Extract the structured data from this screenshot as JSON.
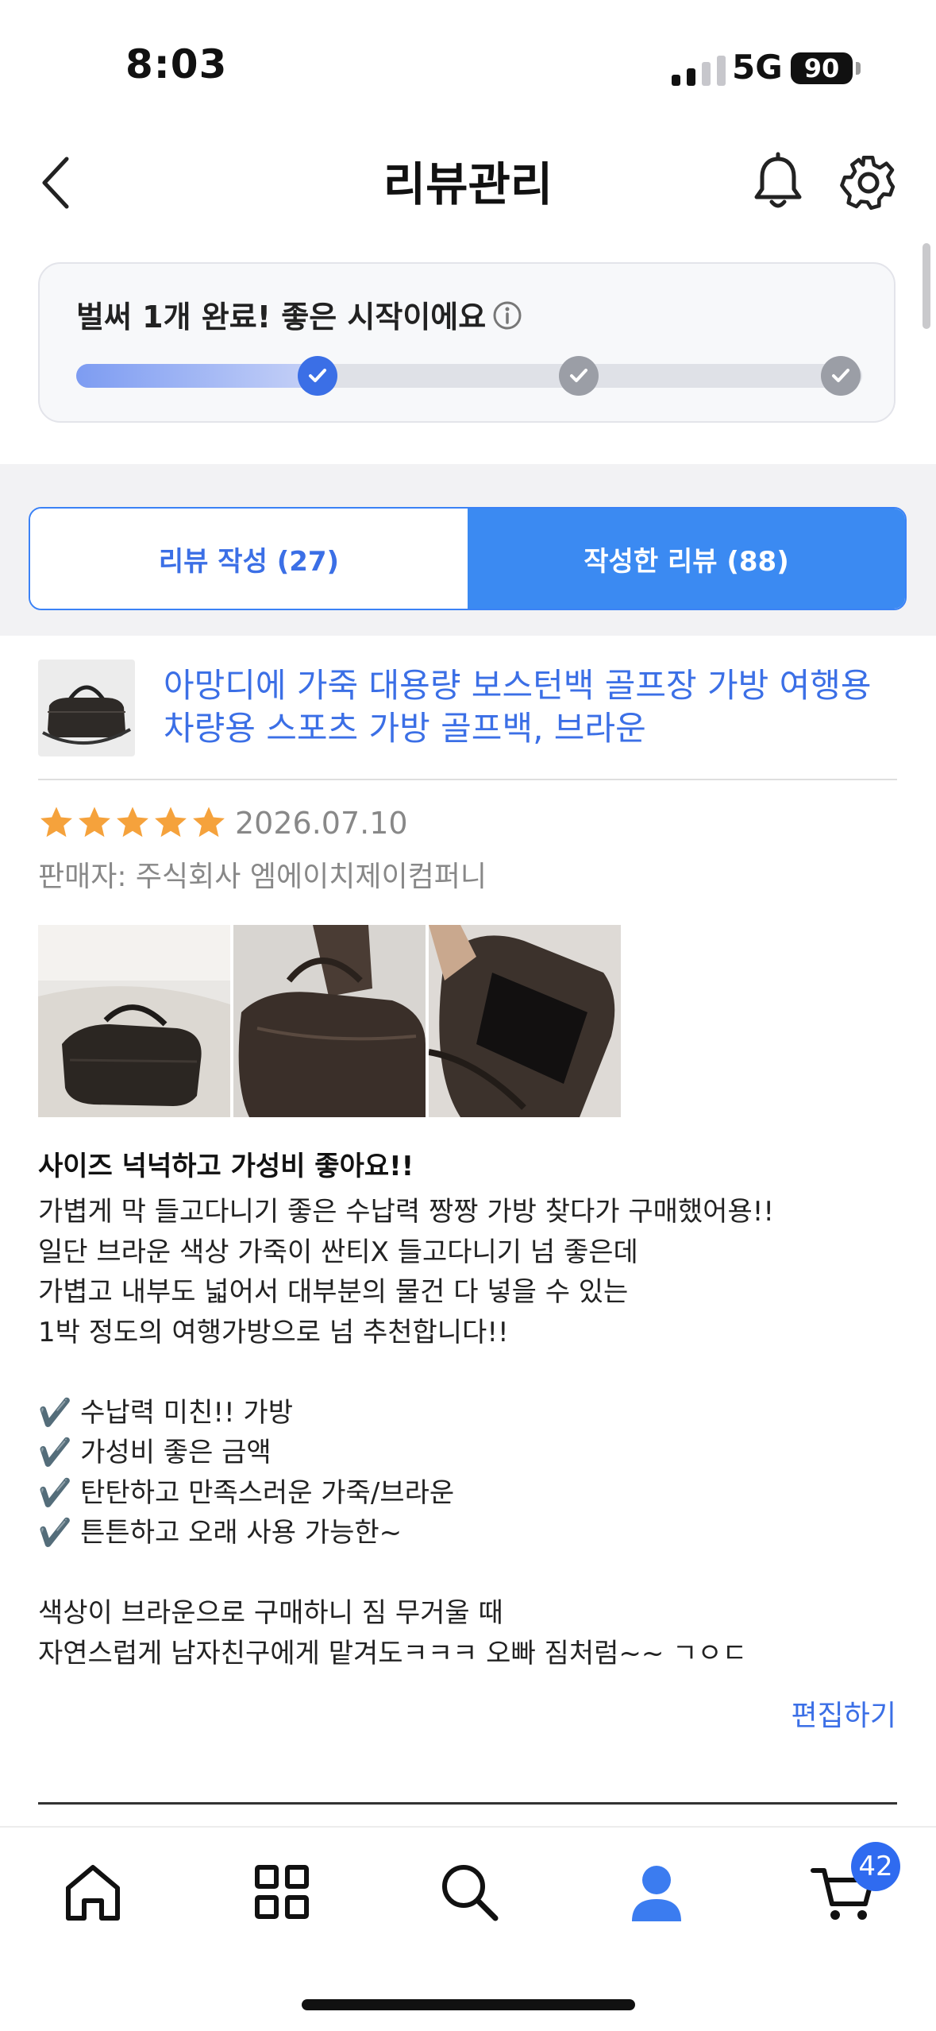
{
  "status_bar": {
    "time": "8:03",
    "network": "5G",
    "battery": "90"
  },
  "header": {
    "title": "리뷰관리"
  },
  "progress": {
    "message": "벌써 1개 완료! 좋은 시작이에요",
    "completed_steps": 1,
    "total_steps": 3,
    "fill_fraction": 0.31
  },
  "tabs": [
    {
      "label": "리뷰 작성 (27)",
      "active": false
    },
    {
      "label": "작성한 리뷰 (88)",
      "active": true
    }
  ],
  "review": {
    "product_title": "아망디에 가죽 대용량 보스턴백 골프장 가방 여행용 차량용 스포츠 가방 골프백, 브라운",
    "rating": 5,
    "date": "2026.07.10",
    "seller": "판매자: 주식회사 엠에이치제이컴퍼니",
    "headline": "사이즈 넉넉하고 가성비 좋아요!!",
    "body": "가볍게 막 들고다니기 좋은 수납력 짱짱 가방 찾다가 구매했어용!!\n일단 브라운 색상 가죽이 싼티X 들고다니기 넘 좋은데\n가볍고 내부도 넓어서 대부분의 물건 다 넣을 수 있는\n1박 정도의 여행가방으로 넘 추천합니다!!\n\n✔️ 수납력 미친!! 가방\n✔️ 가성비 좋은 금액\n✔️ 탄탄하고 만족스러운 가죽/브라운\n✔️ 튼튼하고 오래 사용 가능한~\n\n색상이 브라운으로 구매하니 짐 무거울 때\n자연스럽게 남자친구에게 맡겨도ㅋㅋㅋ 오빠 짐처럼~~ ㄱㅇㄷ",
    "edit_label": "편집하기"
  },
  "bottom_nav": {
    "items": [
      "home-icon",
      "category-grid-icon",
      "search-icon",
      "profile-icon",
      "cart-icon"
    ],
    "cart_badge": "42"
  },
  "colors": {
    "accent": "#3b8af2",
    "link": "#3b6fe6",
    "star": "#f5a23c"
  }
}
